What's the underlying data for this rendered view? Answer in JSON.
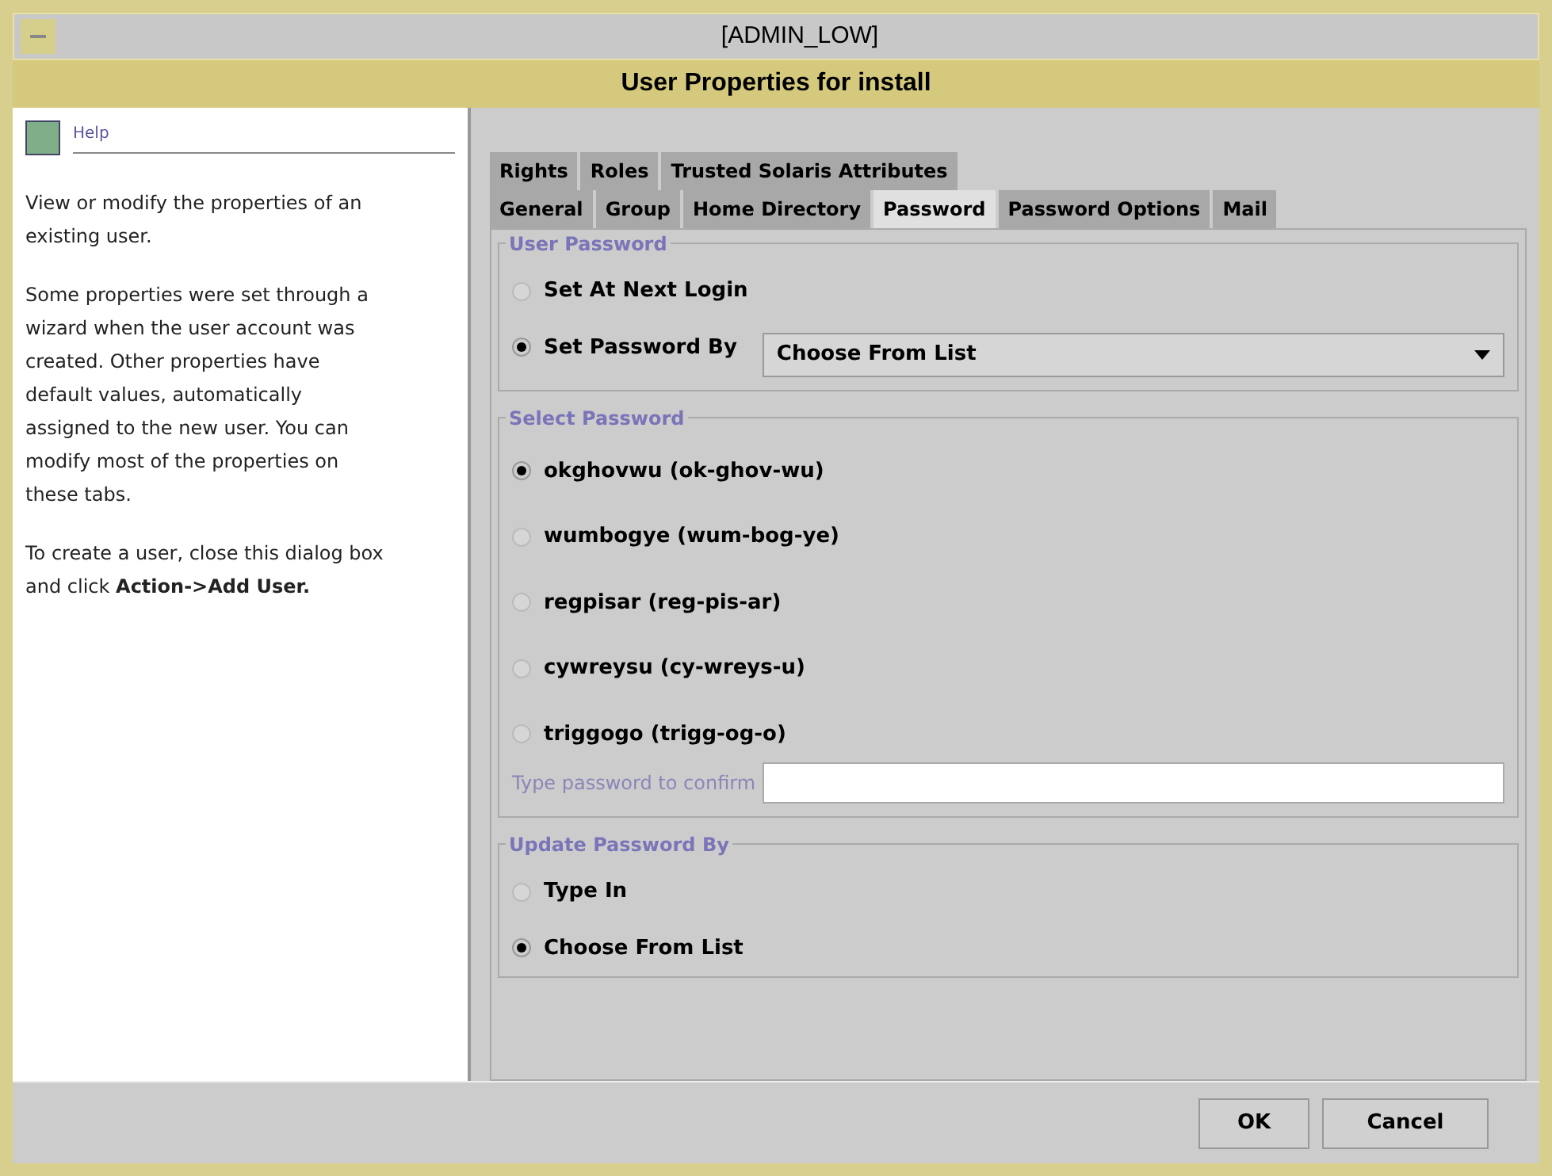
{
  "window": {
    "title": "[ADMIN_LOW]",
    "subtitle": "User Properties for install"
  },
  "help": {
    "title": "Help",
    "paragraphs": [
      "View or modify the properties of an existing user.",
      "Some properties were set through a wizard when the user account was created. Other properties have default values, automatically assigned to the new user. You can modify most of the properties on these tabs.",
      "To create a user, close this dialog box and click **Action->Add User.**"
    ]
  },
  "tab_rows": [
    [
      {
        "label": "Rights",
        "selected": false
      },
      {
        "label": "Roles",
        "selected": false
      },
      {
        "label": "Trusted Solaris Attributes",
        "selected": false
      }
    ],
    [
      {
        "label": "General",
        "selected": false
      },
      {
        "label": "Group",
        "selected": false
      },
      {
        "label": "Home Directory",
        "selected": false
      },
      {
        "label": "Password",
        "selected": true
      },
      {
        "label": "Password Options",
        "selected": false
      },
      {
        "label": "Mail",
        "selected": false
      }
    ]
  ],
  "user_password": {
    "title": "User Password",
    "options": [
      {
        "label": "Set At Next Login",
        "selected": false
      },
      {
        "label": "Set Password By",
        "selected": true
      }
    ],
    "dropdown": {
      "value": "Choose From List"
    }
  },
  "select_password": {
    "title": "Select Password",
    "options": [
      {
        "label": "okghovwu (ok-ghov-wu)",
        "selected": true
      },
      {
        "label": "wumbogye (wum-bog-ye)",
        "selected": false
      },
      {
        "label": "regpisar (reg-pis-ar)",
        "selected": false
      },
      {
        "label": "cywreysu (cy-wreys-u)",
        "selected": false
      },
      {
        "label": "triggogo (trigg-og-o)",
        "selected": false
      }
    ],
    "confirm_label": "Type password to confirm"
  },
  "update_password": {
    "title": "Update Password By",
    "options": [
      {
        "label": "Type In",
        "selected": false
      },
      {
        "label": "Choose From List",
        "selected": true
      }
    ]
  },
  "buttons": [
    "OK",
    "Cancel"
  ]
}
